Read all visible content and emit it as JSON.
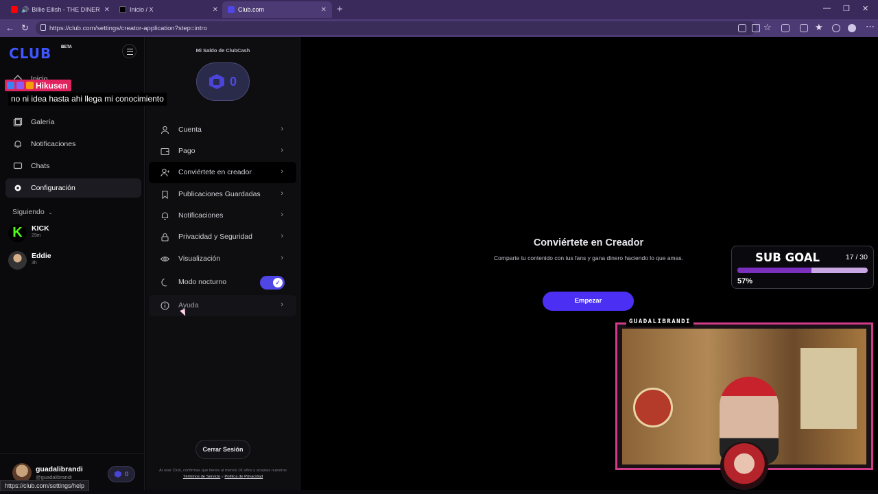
{
  "browser": {
    "tabs": [
      {
        "title": "Billie Eilish - THE DINER (Offic",
        "close": "✕",
        "active": false
      },
      {
        "title": "Inicio / X",
        "close": "✕",
        "active": false
      },
      {
        "title": "Club.com",
        "close": "✕",
        "active": true
      }
    ],
    "new_tab": "+",
    "url": "https://club.com/settings/creator-application?step=intro",
    "status_url": "https://club.com/settings/help"
  },
  "sidebar": {
    "logo": "CLUB",
    "badge": "BETA",
    "items": [
      {
        "label": "Inicio",
        "icon": "home-icon"
      },
      {
        "label": "Galería",
        "icon": "gallery-icon"
      },
      {
        "label": "Notificaciones",
        "icon": "bell-icon"
      },
      {
        "label": "Chats",
        "icon": "chat-icon"
      },
      {
        "label": "Configuración",
        "icon": "gear-icon",
        "active": true
      }
    ],
    "following_label": "Siguiendo",
    "following": [
      {
        "name": "KICK",
        "time": "29m"
      },
      {
        "name": "Eddie",
        "time": "3h"
      }
    ],
    "user": {
      "name": "guadalibrandi",
      "handle": "@guadalibrandi",
      "clubcash": "0"
    }
  },
  "settings": {
    "clubcash_title": "Mi Saldo de ClubCash",
    "clubcash_value": "0",
    "items": [
      {
        "label": "Cuenta",
        "icon": "user-icon"
      },
      {
        "label": "Pago",
        "icon": "wallet-icon"
      },
      {
        "label": "Conviértete en creador",
        "icon": "user-plus-icon",
        "active": true
      },
      {
        "label": "Publicaciones Guardadas",
        "icon": "bookmark-icon"
      },
      {
        "label": "Notificaciones",
        "icon": "bell-icon"
      },
      {
        "label": "Privacidad y Seguridad",
        "icon": "lock-icon"
      },
      {
        "label": "Visualización",
        "icon": "eye-icon"
      }
    ],
    "night_mode_label": "Modo nocturno",
    "night_mode_on": true,
    "help_label": "Ayuda",
    "logout_label": "Cerrar Sesión",
    "terms_prefix": "Al usar Club, confirmas que tienes al menos 18 años y aceptas nuestros",
    "terms_link": "Términos de Servicio",
    "terms_and": "y",
    "privacy_link": "Política de Privacidad"
  },
  "main": {
    "title": "Conviértete en Creador",
    "subtitle": "Comparte tu contenido con tus fans y gana dinero haciendo lo que amas.",
    "start_button": "Empezar"
  },
  "overlay": {
    "chat_user": "Hikusen",
    "chat_message": "no ni idea hasta ahi llega mi conocimiento",
    "sub_goal_title": "SUB GOAL",
    "sub_goal_count": "17 / 30",
    "sub_goal_percent": "57%",
    "sub_goal_fraction": 0.57,
    "cam_tag": "GUADALIBRANDI"
  },
  "colors": {
    "accent": "#4b2ff2",
    "brand": "#3f55ff",
    "chat_badge": "#e0225f",
    "goal_fill": "#7b2fbe"
  }
}
